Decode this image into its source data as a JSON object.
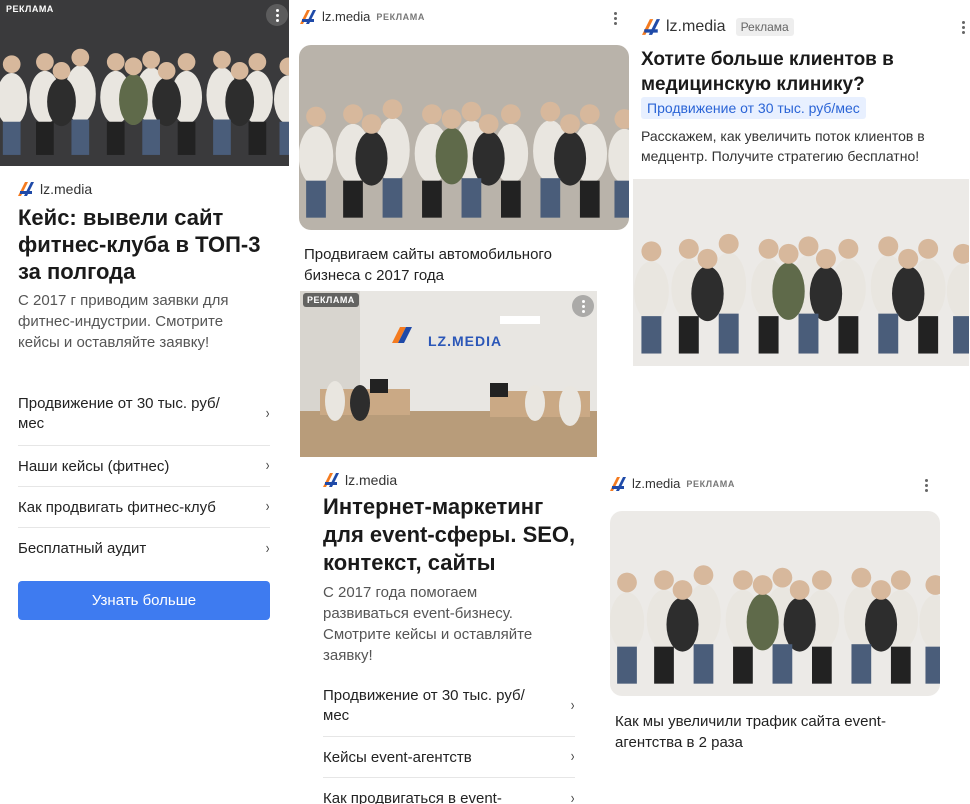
{
  "ad_label": "РЕКЛАМА",
  "ad_label_pill": "Реклама",
  "brand": "lz.media",
  "colors": {
    "accent": "#3e7bf0",
    "pill_bg": "#e8f0ff",
    "pill_text": "#2a64d6",
    "logo_orange": "#f47b20",
    "logo_blue": "#1f4aa8"
  },
  "icons": [
    "lz-media-logo-icon",
    "more-dots-icon",
    "chevron-right-icon"
  ],
  "card_fitness": {
    "title": "Кейс: вывели сайт фитнес-клуба в ТОП-3 за полгода",
    "description": "С 2017 г приводим заявки для фитнес-индустрии. Смотрите кейсы и оставляйте заявку!",
    "links": [
      "Продвижение от 30 тыс. руб/мес",
      "Наши кейсы (фитнес)",
      "Как продвигать фитнес-клуб",
      "Бесплатный аудит"
    ],
    "cta": "Узнать больше"
  },
  "card_auto": {
    "caption": "Продвигаем сайты автомобильного бизнеса с 2017 года"
  },
  "card_office": {
    "wall_logo": "LZ.MEDIA"
  },
  "card_event": {
    "title": "Интернет-маркетинг для event-сферы. SEO, контекст, сайты",
    "description": "С 2017 года помогаем развиваться event-бизнесу. Смотрите кейсы и оставляйте заявку!",
    "links": [
      "Продвижение от 30 тыс. руб/мес",
      "Кейсы event-агентств",
      "Как продвигаться в event-"
    ]
  },
  "card_medical": {
    "title": "Хотите больше клиентов в медицинскую клинику?",
    "promo": "Продвижение от 30 тыс. руб/мес",
    "description": "Расскажем, как увеличить поток клиентов в медцентр. Получите стратегию бесплатно!"
  },
  "card_traffic": {
    "caption": "Как мы увеличили трафик сайта event-агентства в 2 раза"
  }
}
